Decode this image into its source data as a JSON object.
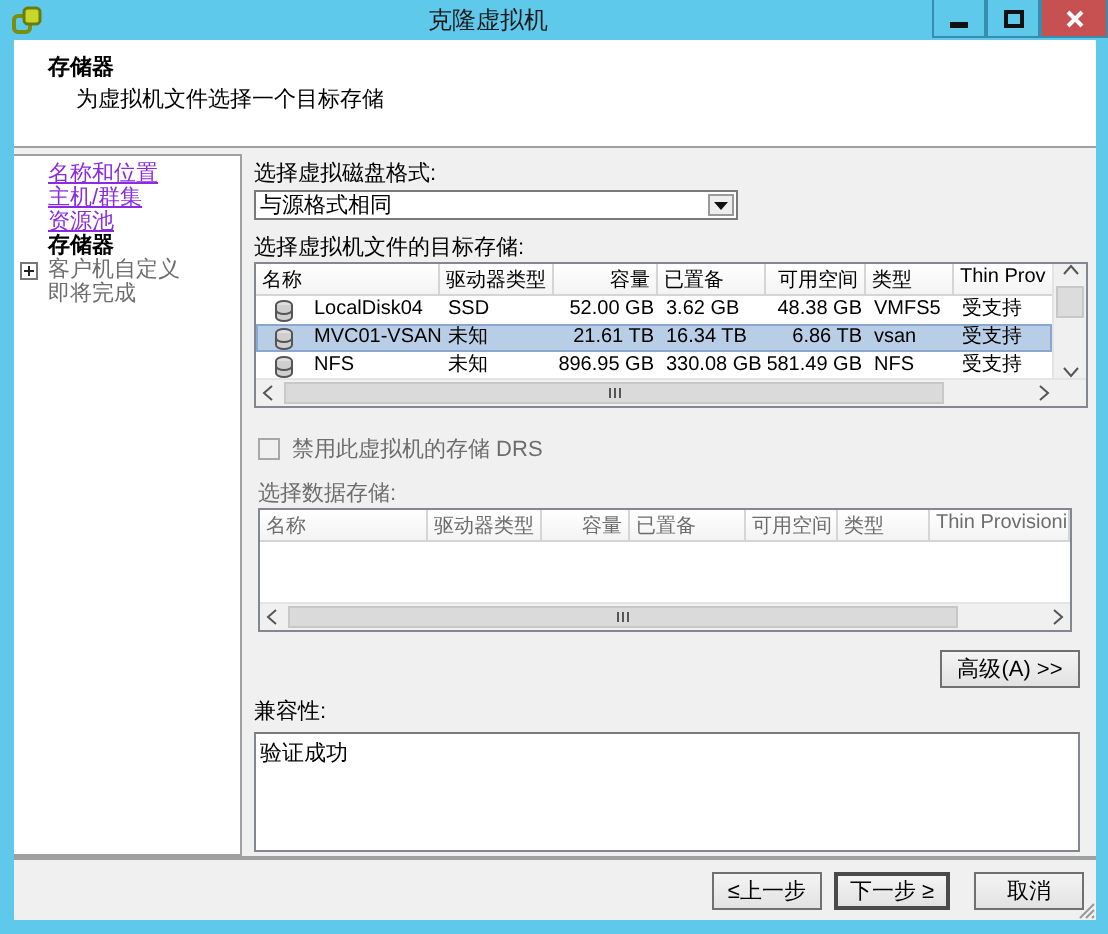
{
  "window": {
    "title": "克隆虚拟机"
  },
  "header": {
    "title": "存储器",
    "subtitle": "为虚拟机文件选择一个目标存储"
  },
  "steps": [
    {
      "label": "名称和位置",
      "kind": "visited",
      "expandable": false
    },
    {
      "label": "主机/群集",
      "kind": "visited",
      "expandable": false
    },
    {
      "label": "资源池",
      "kind": "visited",
      "expandable": false
    },
    {
      "label": "存储器",
      "kind": "current",
      "expandable": false
    },
    {
      "label": "客户机自定义",
      "kind": "pending",
      "expandable": true
    },
    {
      "label": "即将完成",
      "kind": "pending",
      "expandable": false
    }
  ],
  "disk_format": {
    "label": "选择虚拟磁盘格式:",
    "value": "与源格式相同"
  },
  "target_storage": {
    "label": "选择虚拟机文件的目标存储:",
    "columns": [
      "名称",
      "驱动器类型",
      "容量",
      "已置备",
      "可用空间",
      "类型",
      "Thin Prov"
    ],
    "rows": [
      {
        "cells": [
          "LocalDisk04",
          "SSD",
          "52.00 GB",
          "3.62 GB",
          "48.38 GB",
          "VMFS5",
          "受支持"
        ],
        "selected": false
      },
      {
        "cells": [
          "MVC01-VSAN",
          "未知",
          "21.61 TB",
          "16.34 TB",
          "6.86 TB",
          "vsan",
          "受支持"
        ],
        "selected": true
      },
      {
        "cells": [
          "NFS",
          "未知",
          "896.95 GB",
          "330.08 GB",
          "581.49 GB",
          "NFS",
          "受支持"
        ],
        "selected": false
      }
    ]
  },
  "storage_drs": {
    "label": "禁用此虚拟机的存储 DRS",
    "checked": false,
    "disabled": true
  },
  "datastore_picker": {
    "label": "选择数据存储:",
    "disabled": true,
    "columns": [
      "名称",
      "驱动器类型",
      "容量",
      "已置备",
      "可用空间",
      "类型",
      "Thin Provisioni"
    ]
  },
  "advanced_button": {
    "label": "高级(A) >>"
  },
  "compatibility": {
    "label": "兼容性:",
    "message": "验证成功"
  },
  "buttons": [
    {
      "label": "≤上一步",
      "default": false
    },
    {
      "label": "下一步 ≥",
      "default": true
    },
    {
      "label": "取消",
      "default": false
    }
  ]
}
